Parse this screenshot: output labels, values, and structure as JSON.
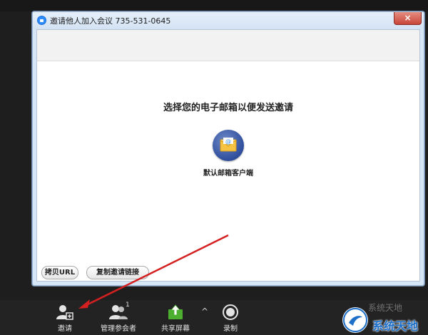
{
  "dialog": {
    "title": "邀请他人加入会议 735-531-0645",
    "close_label": "×",
    "heading": "选择您的电子邮箱以便发送邀请",
    "email_client_label": "默认邮箱客户端",
    "copy_url_label": "拷贝URL",
    "copy_link_label": "复制邀请链接"
  },
  "toolbar": {
    "invite_label": "邀请",
    "manage_label": "管理参会者",
    "participant_count": "1",
    "share_label": "共享屏幕",
    "more_glyph": "^",
    "record_label": "录制"
  },
  "watermark": {
    "text": "系统天地",
    "faint_text": "系统天地"
  },
  "colors": {
    "background": "#1e1e1e",
    "dialog_frame": "#d7e6f6",
    "close_button": "#c8463a",
    "share_icon": "#4caf2f",
    "arrow": "#d42020",
    "watermark": "#1e6fc8"
  },
  "icons": {
    "app": "zoom-logo-icon",
    "mail": "mail-envelope-icon",
    "invite": "add-user-icon",
    "manage": "participants-icon",
    "share": "share-screen-icon",
    "record": "record-icon"
  }
}
